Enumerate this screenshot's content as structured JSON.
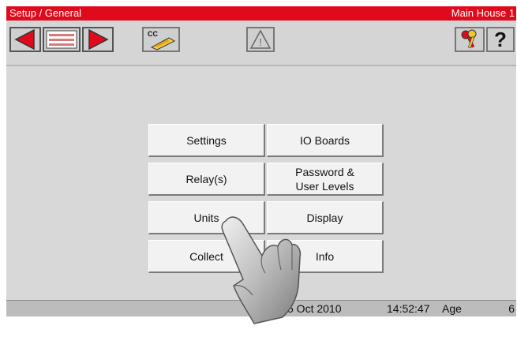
{
  "titlebar": {
    "title": "Setup / General",
    "location": "Main House 1",
    "bg_color": "#e10a1c"
  },
  "toolbar": {
    "icons": [
      "arrow-left-icon",
      "list-icon",
      "arrow-right-icon",
      "cc-card-icon",
      "warning-icon",
      "keys-icon",
      "help-icon"
    ],
    "cc_label": "CC",
    "help_label": "?",
    "warning_label": "!"
  },
  "menu": {
    "settings": "Settings",
    "io_boards": "IO Boards",
    "relays": "Relay(s)",
    "password_levels": "Password &\nUser Levels",
    "units": "Units",
    "display": "Display",
    "collect": "Collect",
    "info": "Info"
  },
  "status": {
    "date": "5 Oct 2010",
    "time": "14:52:47",
    "age_label": "Age",
    "age_value": "6"
  }
}
